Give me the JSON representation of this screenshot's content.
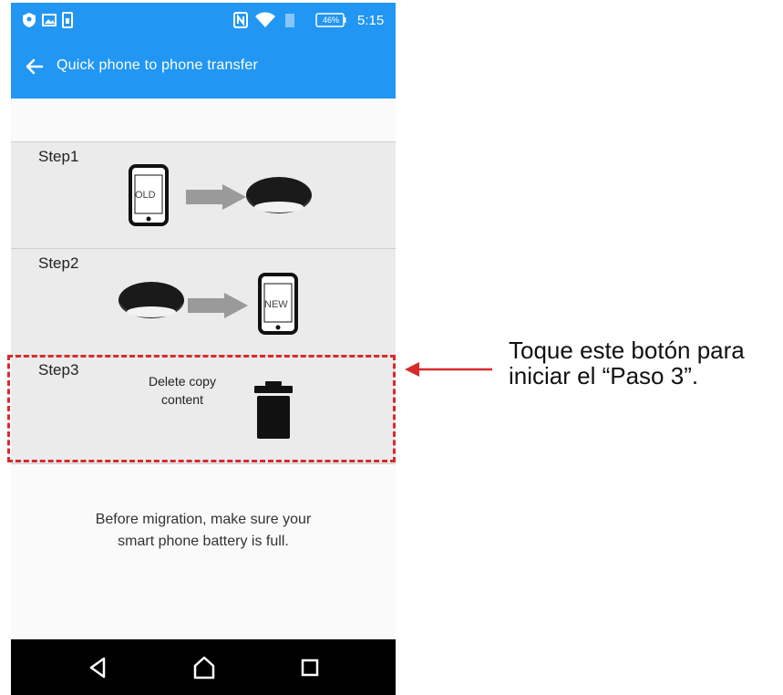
{
  "status_bar": {
    "battery_percent": "46%",
    "time": "5:15",
    "icons": [
      "shield-icon",
      "image-icon",
      "sim-icon",
      "nfc-icon",
      "wifi-icon",
      "signal-icon",
      "battery-icon"
    ]
  },
  "app_bar": {
    "title": "Quick phone to phone transfer",
    "back_icon": "back-arrow-icon"
  },
  "steps": [
    {
      "label": "Step1",
      "phone_label": "OLD",
      "icons": [
        "phone-old-icon",
        "arrow-right-icon",
        "storage-puck-icon"
      ]
    },
    {
      "label": "Step2",
      "phone_label": "NEW",
      "icons": [
        "storage-puck-icon",
        "arrow-right-icon",
        "phone-new-icon"
      ]
    },
    {
      "label": "Step3",
      "text": "Delete copy\ncontent",
      "icon": "trash-icon"
    }
  ],
  "note": "Before migration, make sure your\nsmart phone battery is full.",
  "nav_bar": {
    "icons": [
      "back-nav-icon",
      "home-nav-icon",
      "recents-nav-icon"
    ]
  },
  "annotation": {
    "text": "Toque este botón para\niniciar el “Paso 3”.",
    "color": "#d62c2c"
  },
  "colors": {
    "primary": "#2196f3",
    "highlight": "#d62c2c"
  }
}
